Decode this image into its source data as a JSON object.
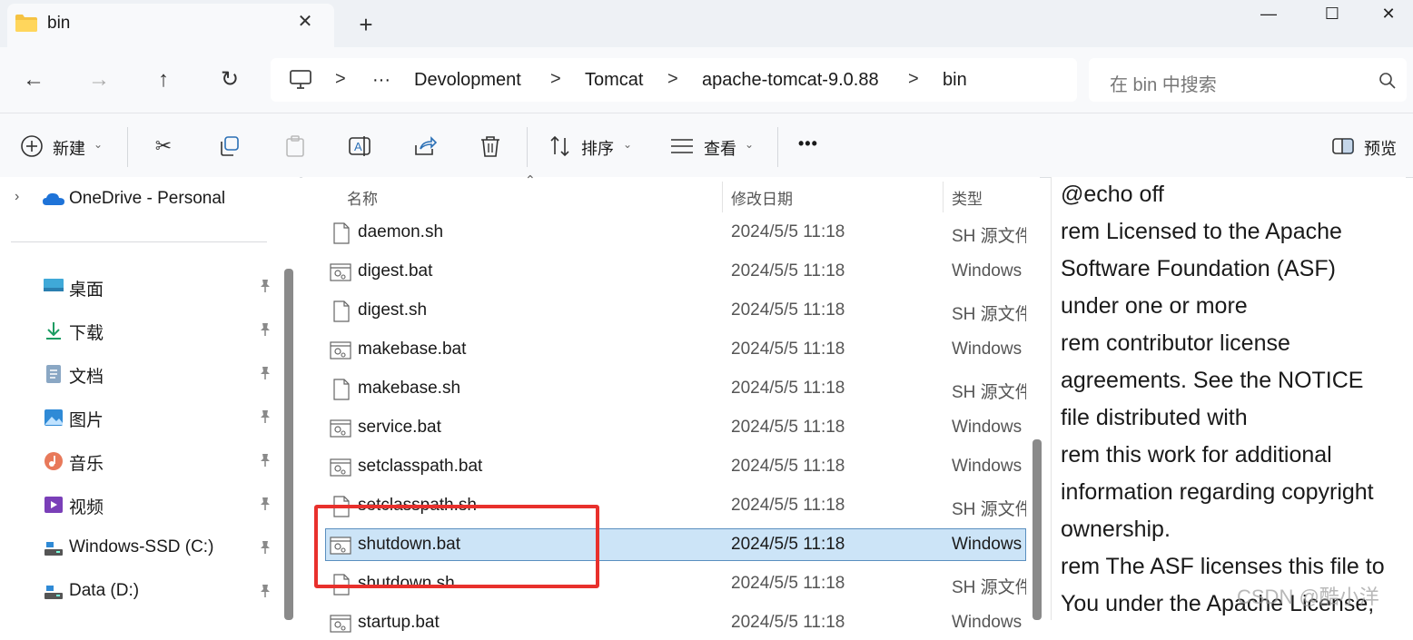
{
  "tab": {
    "title": "bin",
    "close_icon": "close-icon",
    "new_tab": "+"
  },
  "window_controls": {
    "minimize": "—",
    "maximize": "☐",
    "close": "✕"
  },
  "nav": {
    "back": "←",
    "forward": "→",
    "up": "↑",
    "refresh": "↻"
  },
  "breadcrumb": {
    "overflow": "···",
    "items": [
      "Devolopment",
      "Tomcat",
      "apache-tomcat-9.0.88",
      "bin"
    ],
    "separator": ">"
  },
  "search": {
    "placeholder": "在 bin 中搜索"
  },
  "toolbar": {
    "new_label": "新建",
    "sort_label": "排序",
    "view_label": "查看",
    "more": "•••",
    "preview_label": "预览"
  },
  "sidebar": {
    "onedrive": "OneDrive - Personal",
    "items": [
      {
        "label": "桌面",
        "icon": "desktop-icon"
      },
      {
        "label": "下载",
        "icon": "download-icon"
      },
      {
        "label": "文档",
        "icon": "documents-icon"
      },
      {
        "label": "图片",
        "icon": "pictures-icon"
      },
      {
        "label": "音乐",
        "icon": "music-icon"
      },
      {
        "label": "视频",
        "icon": "video-icon"
      },
      {
        "label": "Windows-SSD (C:)",
        "icon": "drive-icon"
      },
      {
        "label": "Data (D:)",
        "icon": "drive-icon"
      }
    ]
  },
  "file_list": {
    "columns": {
      "name": "名称",
      "date": "修改日期",
      "type": "类型"
    },
    "files": [
      {
        "name": "daemon.sh",
        "date": "2024/5/5 11:18",
        "type": "SH 源文件",
        "kind": "sh"
      },
      {
        "name": "digest.bat",
        "date": "2024/5/5 11:18",
        "type": "Windows",
        "kind": "bat"
      },
      {
        "name": "digest.sh",
        "date": "2024/5/5 11:18",
        "type": "SH 源文件",
        "kind": "sh"
      },
      {
        "name": "makebase.bat",
        "date": "2024/5/5 11:18",
        "type": "Windows",
        "kind": "bat"
      },
      {
        "name": "makebase.sh",
        "date": "2024/5/5 11:18",
        "type": "SH 源文件",
        "kind": "sh"
      },
      {
        "name": "service.bat",
        "date": "2024/5/5 11:18",
        "type": "Windows",
        "kind": "bat"
      },
      {
        "name": "setclasspath.bat",
        "date": "2024/5/5 11:18",
        "type": "Windows",
        "kind": "bat"
      },
      {
        "name": "setclasspath.sh",
        "date": "2024/5/5 11:18",
        "type": "SH 源文件",
        "kind": "sh"
      },
      {
        "name": "shutdown.bat",
        "date": "2024/5/5 11:18",
        "type": "Windows",
        "kind": "bat",
        "selected": true
      },
      {
        "name": "shutdown.sh",
        "date": "2024/5/5 11:18",
        "type": "SH 源文件",
        "kind": "sh"
      },
      {
        "name": "startup.bat",
        "date": "2024/5/5 11:18",
        "type": "Windows",
        "kind": "bat"
      }
    ]
  },
  "preview": {
    "lines": [
      "@echo off",
      "rem Licensed to the Apache",
      "Software Foundation (ASF)",
      "under one or more",
      "rem contributor license",
      "agreements.  See the NOTICE",
      "file distributed with",
      "rem this work for additional",
      "information regarding copyright",
      "ownership.",
      "rem The ASF licenses this file to",
      "You under the Apache License,"
    ]
  },
  "watermark": "CSDN @酷小洋",
  "colors": {
    "selection": "#cce4f7",
    "highlight": "#e8302c",
    "accent": "#0067c0"
  }
}
